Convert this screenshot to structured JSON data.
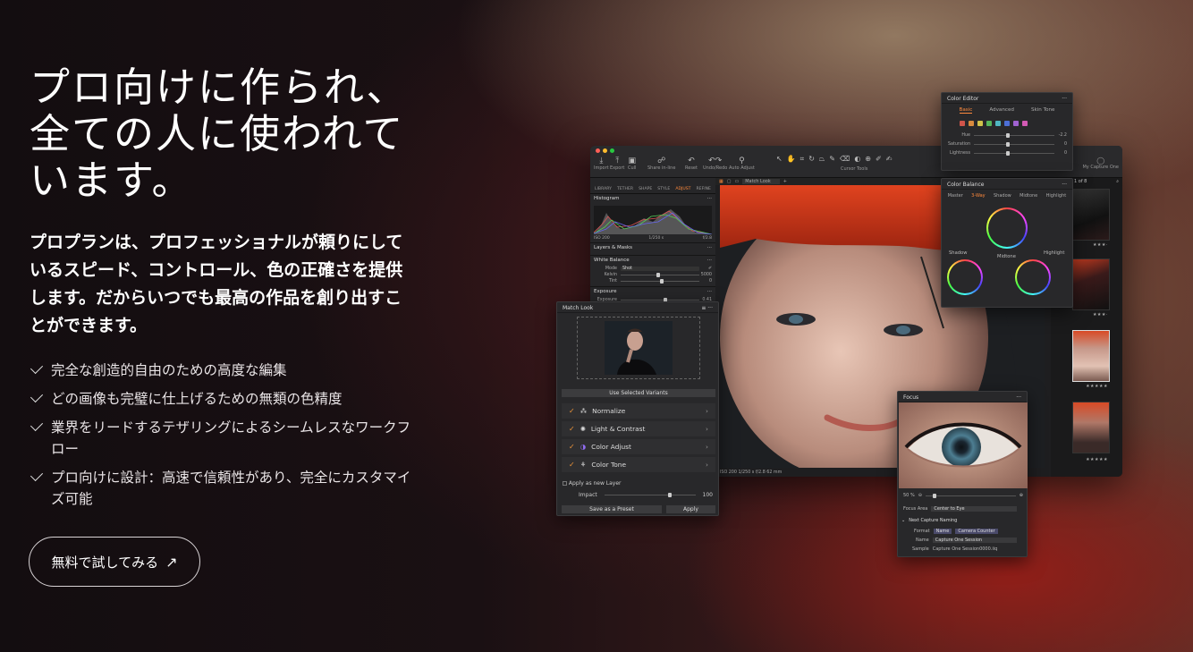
{
  "hero": {
    "headline": "プロ向けに作られ、\n全ての人に使われて\nいます。",
    "lead": "プロプランは、プロフェッショナルが頼りにして\nいるスピード、コントロール、色の正確さを提供\nします。だからいつでも最高の作品を創り出すこ\nとができます。",
    "features": [
      "完全な創造的自由のための高度な編集",
      "どの画像も完璧に仕上げるための無類の色精度",
      "業界をリードするテザリングによるシームレスなワークフ\nロー",
      "プロ向けに設計：高速で信頼性があり、完全にカスタマイ\nズ可能"
    ],
    "cta_label": "無料で試してみる",
    "cta_arrow": "↗"
  },
  "colors": {
    "accent": "#ff8a3d",
    "check": "#f0963a"
  },
  "app": {
    "toolbar": [
      {
        "label": "Import",
        "icon": "import-icon"
      },
      {
        "label": "Export",
        "icon": "export-icon"
      },
      {
        "label": "Cull",
        "icon": "cull-icon"
      },
      {
        "label": "Share in-line",
        "icon": "share-icon"
      },
      {
        "label": "Reset",
        "icon": "reset-icon"
      },
      {
        "label": "Undo/Redo",
        "icon": "undo-icon"
      },
      {
        "label": "Auto Adjust",
        "icon": "wand-icon"
      }
    ],
    "cursor_tools_label": "Cursor Tools",
    "user_label": "My Capture One",
    "tabs": [
      "LIBRARY",
      "TETHER",
      "SHAPE",
      "STYLE",
      "ADJUST",
      "REFINE"
    ],
    "active_tab": "ADJUST",
    "histogram": {
      "title": "Histogram",
      "iso": "ISO 200",
      "shutter": "1/250 s",
      "aperture": "f/2.8"
    },
    "layers_title": "Layers & Masks",
    "white_balance": {
      "title": "White Balance",
      "mode_label": "Mode",
      "mode_value": "Shot",
      "kelvin_label": "Kelvin",
      "kelvin_value": "5000",
      "tint_label": "Tint",
      "tint_value": "0"
    },
    "exposure": {
      "title": "Exposure",
      "label": "Exposure",
      "value": "0.41"
    },
    "viewer_dropdown": "Match Look",
    "photo_info": "ISO 200   1/250 s   f/2.8   62 mm",
    "filmstrip_count": "1 of 8",
    "rating_stars": "★★★★★",
    "rating_stars_small": "★★★·"
  },
  "match_look": {
    "title": "Match Look",
    "use_selected": "Use Selected Variants",
    "options": [
      {
        "label": "Normalize",
        "icon": "normalize-icon"
      },
      {
        "label": "Light & Contrast",
        "icon": "light-icon"
      },
      {
        "label": "Color Adjust",
        "icon": "color-adjust-icon"
      },
      {
        "label": "Color Tone",
        "icon": "color-tone-icon"
      }
    ],
    "apply_new_layer": "Apply as new Layer",
    "impact_label": "Impact",
    "impact_value": "100",
    "save_preset": "Save as a Preset",
    "apply": "Apply"
  },
  "color_editor": {
    "title": "Color Editor",
    "tabs": [
      "Basic",
      "Advanced",
      "Skin Tone"
    ],
    "active_tab": "Basic",
    "swatches": [
      "#d0544a",
      "#d88a3e",
      "#d0c24a",
      "#55b55a",
      "#4fb6c0",
      "#4c6fd6",
      "#a062d0",
      "#d25ab4"
    ],
    "hue_label": "Hue",
    "hue_value": "-2.2",
    "saturation_label": "Saturation",
    "saturation_value": "0",
    "lightness_label": "Lightness",
    "lightness_value": "0"
  },
  "color_balance": {
    "title": "Color Balance",
    "tabs": [
      "Master",
      "3-Way",
      "Shadow",
      "Midtone",
      "Highlight"
    ],
    "active_tab": "3-Way",
    "shadow": "Shadow",
    "midtone": "Midtone",
    "highlight": "Highlight"
  },
  "focus": {
    "title": "Focus",
    "zoom": "50 %",
    "area_label": "Focus Area",
    "area_value": "Center to Eye",
    "naming_title": "Next Capture Naming",
    "format_label": "Format",
    "format_tokens": [
      "Name",
      "Camera Counter"
    ],
    "name_label": "Name",
    "name_value": "Capture One Session",
    "sample_label": "Sample",
    "sample_value": "Capture One Session0000.iiq"
  }
}
